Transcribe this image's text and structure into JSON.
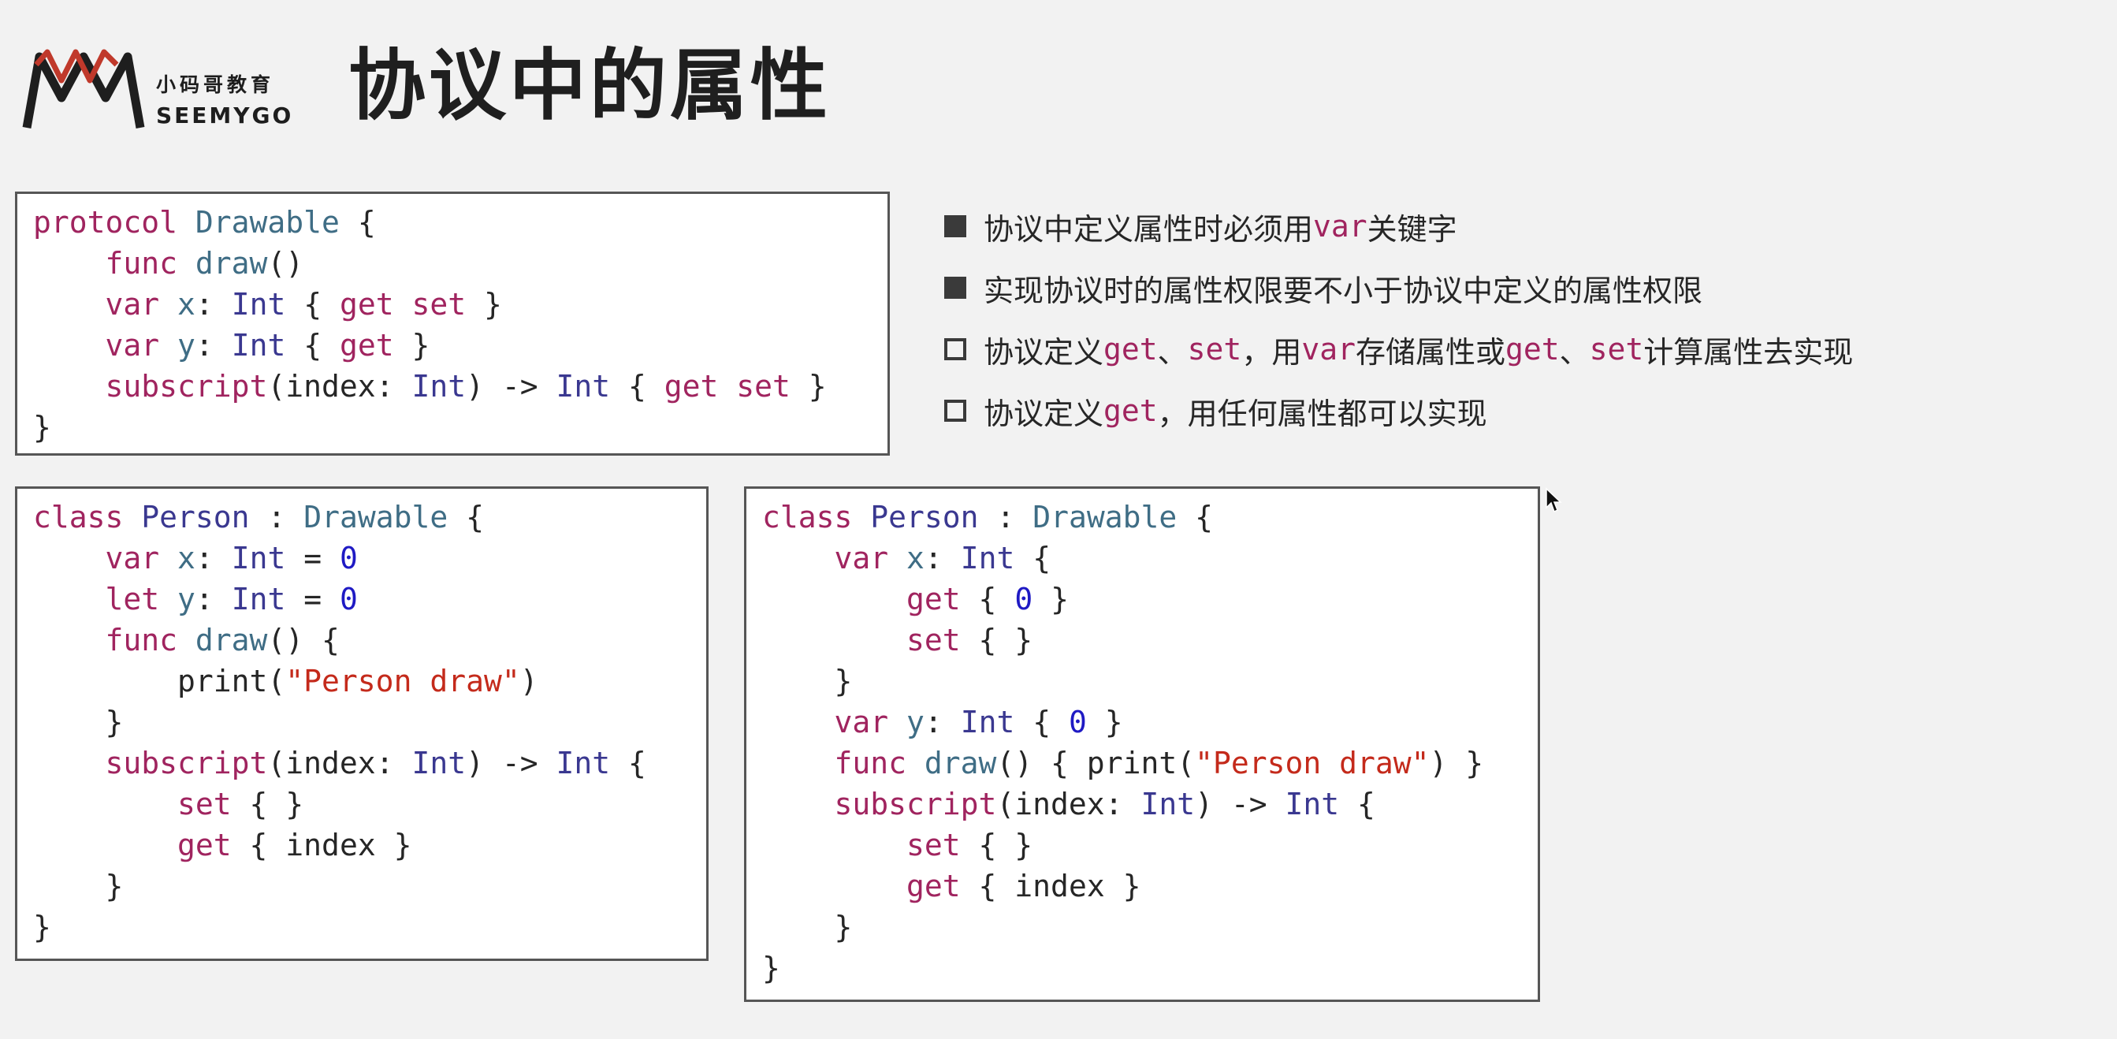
{
  "logo": {
    "chinese": "小码哥教育",
    "english": "SEEMYGO",
    "colors": {
      "dark": "#1e1e1e",
      "red": "#c0392b"
    }
  },
  "title": "协议中的属性",
  "bullets": [
    {
      "style": "filled",
      "parts": [
        {
          "text": "协议中定义属性时必须用",
          "code": false
        },
        {
          "text": "var",
          "code": true
        },
        {
          "text": "关键字",
          "code": false
        }
      ]
    },
    {
      "style": "filled",
      "parts": [
        {
          "text": "实现协议时的属性权限要不小于协议中定义的属性权限",
          "code": false
        }
      ]
    },
    {
      "style": "hollow",
      "parts": [
        {
          "text": "协议定义",
          "code": false
        },
        {
          "text": "get",
          "code": true
        },
        {
          "text": "、",
          "code": false
        },
        {
          "text": "set",
          "code": true
        },
        {
          "text": "，用",
          "code": false
        },
        {
          "text": "var",
          "code": true
        },
        {
          "text": "存储属性或",
          "code": false
        },
        {
          "text": "get",
          "code": true
        },
        {
          "text": "、",
          "code": false
        },
        {
          "text": "set",
          "code": true
        },
        {
          "text": "计算属性去实现",
          "code": false
        }
      ]
    },
    {
      "style": "hollow",
      "parts": [
        {
          "text": "协议定义",
          "code": false
        },
        {
          "text": "get",
          "code": true
        },
        {
          "text": "，用任何属性都可以实现",
          "code": false
        }
      ]
    }
  ],
  "code_blocks": {
    "protocol": [
      [
        [
          "kw",
          "protocol "
        ],
        [
          "ty2",
          "Drawable"
        ],
        [
          "pl",
          " {"
        ]
      ],
      [
        [
          "pl",
          "    "
        ],
        [
          "kw",
          "func "
        ],
        [
          "ty2",
          "draw"
        ],
        [
          "pl",
          "()"
        ]
      ],
      [
        [
          "pl",
          "    "
        ],
        [
          "kw",
          "var "
        ],
        [
          "ty2",
          "x"
        ],
        [
          "pl",
          ": "
        ],
        [
          "ty",
          "Int"
        ],
        [
          "pl",
          " { "
        ],
        [
          "kw",
          "get set"
        ],
        [
          "pl",
          " }"
        ]
      ],
      [
        [
          "pl",
          "    "
        ],
        [
          "kw",
          "var "
        ],
        [
          "ty2",
          "y"
        ],
        [
          "pl",
          ": "
        ],
        [
          "ty",
          "Int"
        ],
        [
          "pl",
          " { "
        ],
        [
          "kw",
          "get"
        ],
        [
          "pl",
          " }"
        ]
      ],
      [
        [
          "pl",
          "    "
        ],
        [
          "kw",
          "subscript"
        ],
        [
          "pl",
          "(index: "
        ],
        [
          "ty",
          "Int"
        ],
        [
          "pl",
          ") -> "
        ],
        [
          "ty",
          "Int"
        ],
        [
          "pl",
          " { "
        ],
        [
          "kw",
          "get set"
        ],
        [
          "pl",
          " }"
        ]
      ],
      [
        [
          "pl",
          "}"
        ]
      ]
    ],
    "stored_impl": [
      [
        [
          "kw",
          "class "
        ],
        [
          "ty",
          "Person"
        ],
        [
          "pl",
          " : "
        ],
        [
          "ty2",
          "Drawable"
        ],
        [
          "pl",
          " {"
        ]
      ],
      [
        [
          "pl",
          "    "
        ],
        [
          "kw",
          "var "
        ],
        [
          "ty2",
          "x"
        ],
        [
          "pl",
          ": "
        ],
        [
          "ty",
          "Int"
        ],
        [
          "pl",
          " = "
        ],
        [
          "num",
          "0"
        ]
      ],
      [
        [
          "pl",
          "    "
        ],
        [
          "kw",
          "let "
        ],
        [
          "ty2",
          "y"
        ],
        [
          "pl",
          ": "
        ],
        [
          "ty",
          "Int"
        ],
        [
          "pl",
          " = "
        ],
        [
          "num",
          "0"
        ]
      ],
      [
        [
          "pl",
          "    "
        ],
        [
          "kw",
          "func "
        ],
        [
          "ty2",
          "draw"
        ],
        [
          "pl",
          "() {"
        ]
      ],
      [
        [
          "pl",
          "        print("
        ],
        [
          "str",
          "\"Person draw\""
        ],
        [
          "pl",
          ")"
        ]
      ],
      [
        [
          "pl",
          "    }"
        ]
      ],
      [
        [
          "pl",
          "    "
        ],
        [
          "kw",
          "subscript"
        ],
        [
          "pl",
          "(index: "
        ],
        [
          "ty",
          "Int"
        ],
        [
          "pl",
          ") -> "
        ],
        [
          "ty",
          "Int"
        ],
        [
          "pl",
          " {"
        ]
      ],
      [
        [
          "pl",
          "        "
        ],
        [
          "kw",
          "set"
        ],
        [
          "pl",
          " { }"
        ]
      ],
      [
        [
          "pl",
          "        "
        ],
        [
          "kw",
          "get"
        ],
        [
          "pl",
          " { index }"
        ]
      ],
      [
        [
          "pl",
          "    }"
        ]
      ],
      [
        [
          "pl",
          "}"
        ]
      ]
    ],
    "computed_impl": [
      [
        [
          "kw",
          "class "
        ],
        [
          "ty",
          "Person"
        ],
        [
          "pl",
          " : "
        ],
        [
          "ty2",
          "Drawable"
        ],
        [
          "pl",
          " {"
        ]
      ],
      [
        [
          "pl",
          "    "
        ],
        [
          "kw",
          "var "
        ],
        [
          "ty2",
          "x"
        ],
        [
          "pl",
          ": "
        ],
        [
          "ty",
          "Int"
        ],
        [
          "pl",
          " {"
        ]
      ],
      [
        [
          "pl",
          "        "
        ],
        [
          "kw",
          "get"
        ],
        [
          "pl",
          " { "
        ],
        [
          "num",
          "0"
        ],
        [
          "pl",
          " }"
        ]
      ],
      [
        [
          "pl",
          "        "
        ],
        [
          "kw",
          "set"
        ],
        [
          "pl",
          " { }"
        ]
      ],
      [
        [
          "pl",
          "    }"
        ]
      ],
      [
        [
          "pl",
          "    "
        ],
        [
          "kw",
          "var "
        ],
        [
          "ty2",
          "y"
        ],
        [
          "pl",
          ": "
        ],
        [
          "ty",
          "Int"
        ],
        [
          "pl",
          " { "
        ],
        [
          "num",
          "0"
        ],
        [
          "pl",
          " }"
        ]
      ],
      [
        [
          "pl",
          "    "
        ],
        [
          "kw",
          "func "
        ],
        [
          "ty2",
          "draw"
        ],
        [
          "pl",
          "() { print("
        ],
        [
          "str",
          "\"Person draw\""
        ],
        [
          "pl",
          ") }"
        ]
      ],
      [
        [
          "pl",
          "    "
        ],
        [
          "kw",
          "subscript"
        ],
        [
          "pl",
          "(index: "
        ],
        [
          "ty",
          "Int"
        ],
        [
          "pl",
          ") -> "
        ],
        [
          "ty",
          "Int"
        ],
        [
          "pl",
          " {"
        ]
      ],
      [
        [
          "pl",
          "        "
        ],
        [
          "kw",
          "set"
        ],
        [
          "pl",
          " { }"
        ]
      ],
      [
        [
          "pl",
          "        "
        ],
        [
          "kw",
          "get"
        ],
        [
          "pl",
          " { index }"
        ]
      ],
      [
        [
          "pl",
          "    }"
        ]
      ],
      [
        [
          "pl",
          "}"
        ]
      ]
    ]
  },
  "syntax_colors": {
    "keyword": "#a0245f",
    "type": "#3a3890",
    "identifier": "#3f6d85",
    "string": "#c42a1b",
    "number": "#1f1ac4"
  }
}
